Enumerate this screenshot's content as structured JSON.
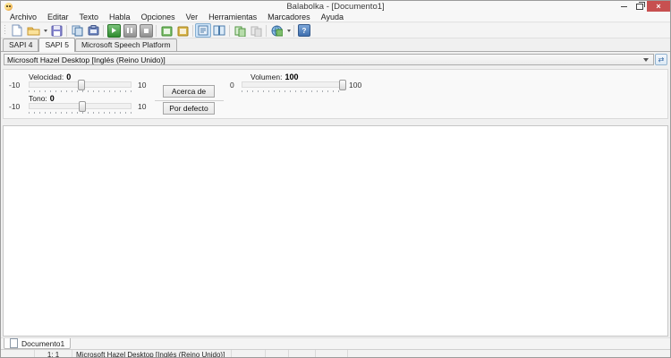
{
  "window": {
    "title": "Balabolka - [Documento1]",
    "controls": {
      "close": "×"
    }
  },
  "menu": {
    "items": [
      "Archivo",
      "Editar",
      "Texto",
      "Habla",
      "Opciones",
      "Ver",
      "Herramientas",
      "Marcadores",
      "Ayuda"
    ]
  },
  "toolbar": {
    "icons": [
      "new-document",
      "open-file",
      "save-file",
      "copy",
      "paste",
      "play",
      "pause",
      "stop",
      "save-audio-file",
      "open-audio-file",
      "text-view-active",
      "split-view",
      "compare-files",
      "compare-files-disabled",
      "language-tools",
      "help"
    ],
    "help_glyph": "?",
    "refresh_glyph": "⇄"
  },
  "engine_tabs": {
    "items": [
      {
        "label": "SAPI 4"
      },
      {
        "label": "SAPI 5"
      },
      {
        "label": "Microsoft Speech Platform"
      }
    ],
    "active": "SAPI 5"
  },
  "voice_select": {
    "value": "Microsoft Hazel Desktop [Inglés (Reino Unido)]"
  },
  "settings": {
    "speed": {
      "label": "Velocidad:",
      "value": "0",
      "min": "-10",
      "max": "10"
    },
    "pitch": {
      "label": "Tono:",
      "value": "0",
      "min": "-10",
      "max": "10"
    },
    "volume": {
      "label": "Volumen:",
      "value": "100",
      "min": "0",
      "max": "100"
    },
    "about_button": "Acerca de",
    "default_button": "Por defecto"
  },
  "document_tabs": {
    "items": [
      {
        "label": "Documento1"
      }
    ]
  },
  "status_bar": {
    "cells": [
      "",
      "1:  1",
      "Microsoft Hazel Desktop [Inglés (Reino Unido)]",
      "",
      "",
      "",
      "",
      ""
    ]
  }
}
